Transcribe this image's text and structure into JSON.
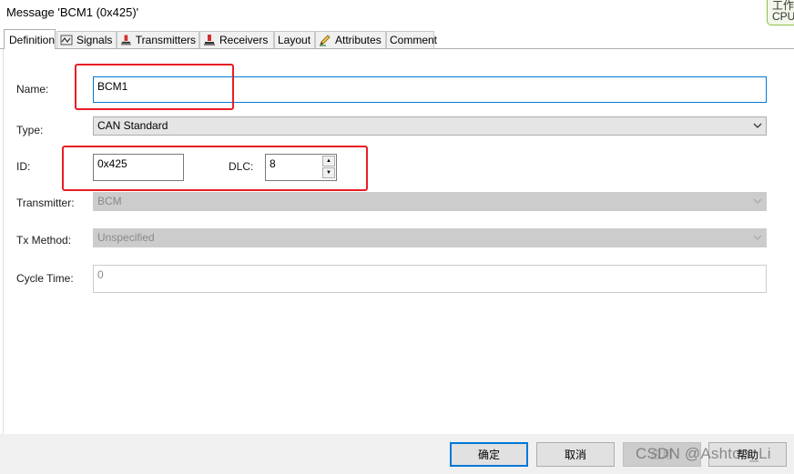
{
  "window": {
    "title": "Message 'BCM1 (0x425)'"
  },
  "overlay": {
    "line1": "工作",
    "line2": "CPU"
  },
  "tabs": [
    {
      "label": "Definition",
      "icon": "none",
      "active": true
    },
    {
      "label": "Signals",
      "icon": "signal-wave-icon"
    },
    {
      "label": "Transmitters",
      "icon": "transmitter-icon"
    },
    {
      "label": "Receivers",
      "icon": "receiver-icon"
    },
    {
      "label": "Layout",
      "icon": "none"
    },
    {
      "label": "Attributes",
      "icon": "pencil-icon"
    },
    {
      "label": "Comment",
      "icon": "none"
    }
  ],
  "form": {
    "name_label": "Name:",
    "name_value": "BCM1",
    "type_label": "Type:",
    "type_value": "CAN Standard",
    "id_label": "ID:",
    "id_value": "0x425",
    "dlc_label": "DLC:",
    "dlc_value": "8",
    "transmitter_label": "Transmitter:",
    "transmitter_value": "BCM",
    "txmethod_label": "Tx Method:",
    "txmethod_value": "Unspecified",
    "cycletime_label": "Cycle Time:",
    "cycletime_value": "0"
  },
  "buttons": {
    "ok": "确定",
    "cancel": "取消",
    "apply": "应用",
    "help": "帮助"
  },
  "watermark": "CSDN @Ashton_Li",
  "colors": {
    "annotation": "#e81e25",
    "focus": "#0078d7"
  }
}
